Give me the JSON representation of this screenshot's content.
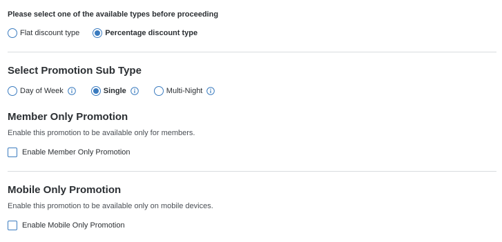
{
  "discount": {
    "instruction": "Please select one of the available types before proceeding",
    "options": [
      {
        "label": "Flat discount type",
        "selected": false
      },
      {
        "label": "Percentage discount type",
        "selected": true
      }
    ]
  },
  "subtype": {
    "title": "Select Promotion Sub Type",
    "options": [
      {
        "label": "Day of Week",
        "selected": false,
        "info_icon": "info-icon"
      },
      {
        "label": "Single",
        "selected": true,
        "info_icon": "info-icon"
      },
      {
        "label": "Multi-Night",
        "selected": false,
        "info_icon": "info-icon"
      }
    ]
  },
  "member_only": {
    "title": "Member Only Promotion",
    "description": "Enable this promotion to be available only for members.",
    "checkbox_label": "Enable Member Only Promotion",
    "checked": false
  },
  "mobile_only": {
    "title": "Mobile Only Promotion",
    "description": "Enable this promotion to be available only on mobile devices.",
    "checkbox_label": "Enable Mobile Only Promotion",
    "checked": false
  },
  "colors": {
    "accent": "#3a7bbf",
    "text": "#2b2f33",
    "divider": "#d9dcdf"
  }
}
